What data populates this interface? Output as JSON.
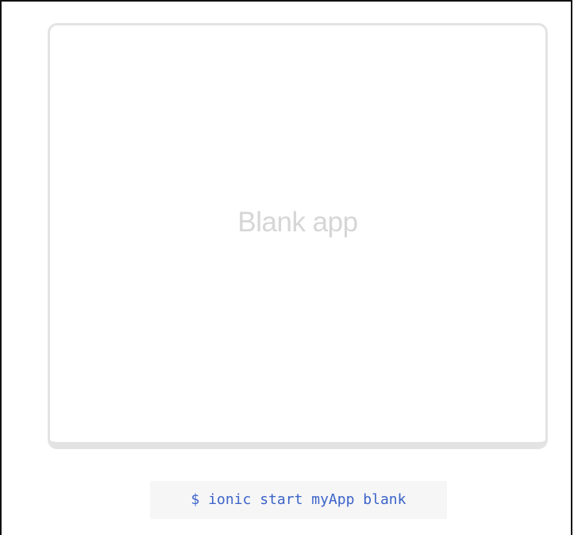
{
  "preview": {
    "label": "Blank app"
  },
  "command": {
    "text": "$ ionic start myApp blank"
  },
  "colors": {
    "card_border": "#e3e3e3",
    "label_text": "#d6d6d6",
    "command_text": "#3b63c8",
    "command_background": "#f6f6f7"
  }
}
